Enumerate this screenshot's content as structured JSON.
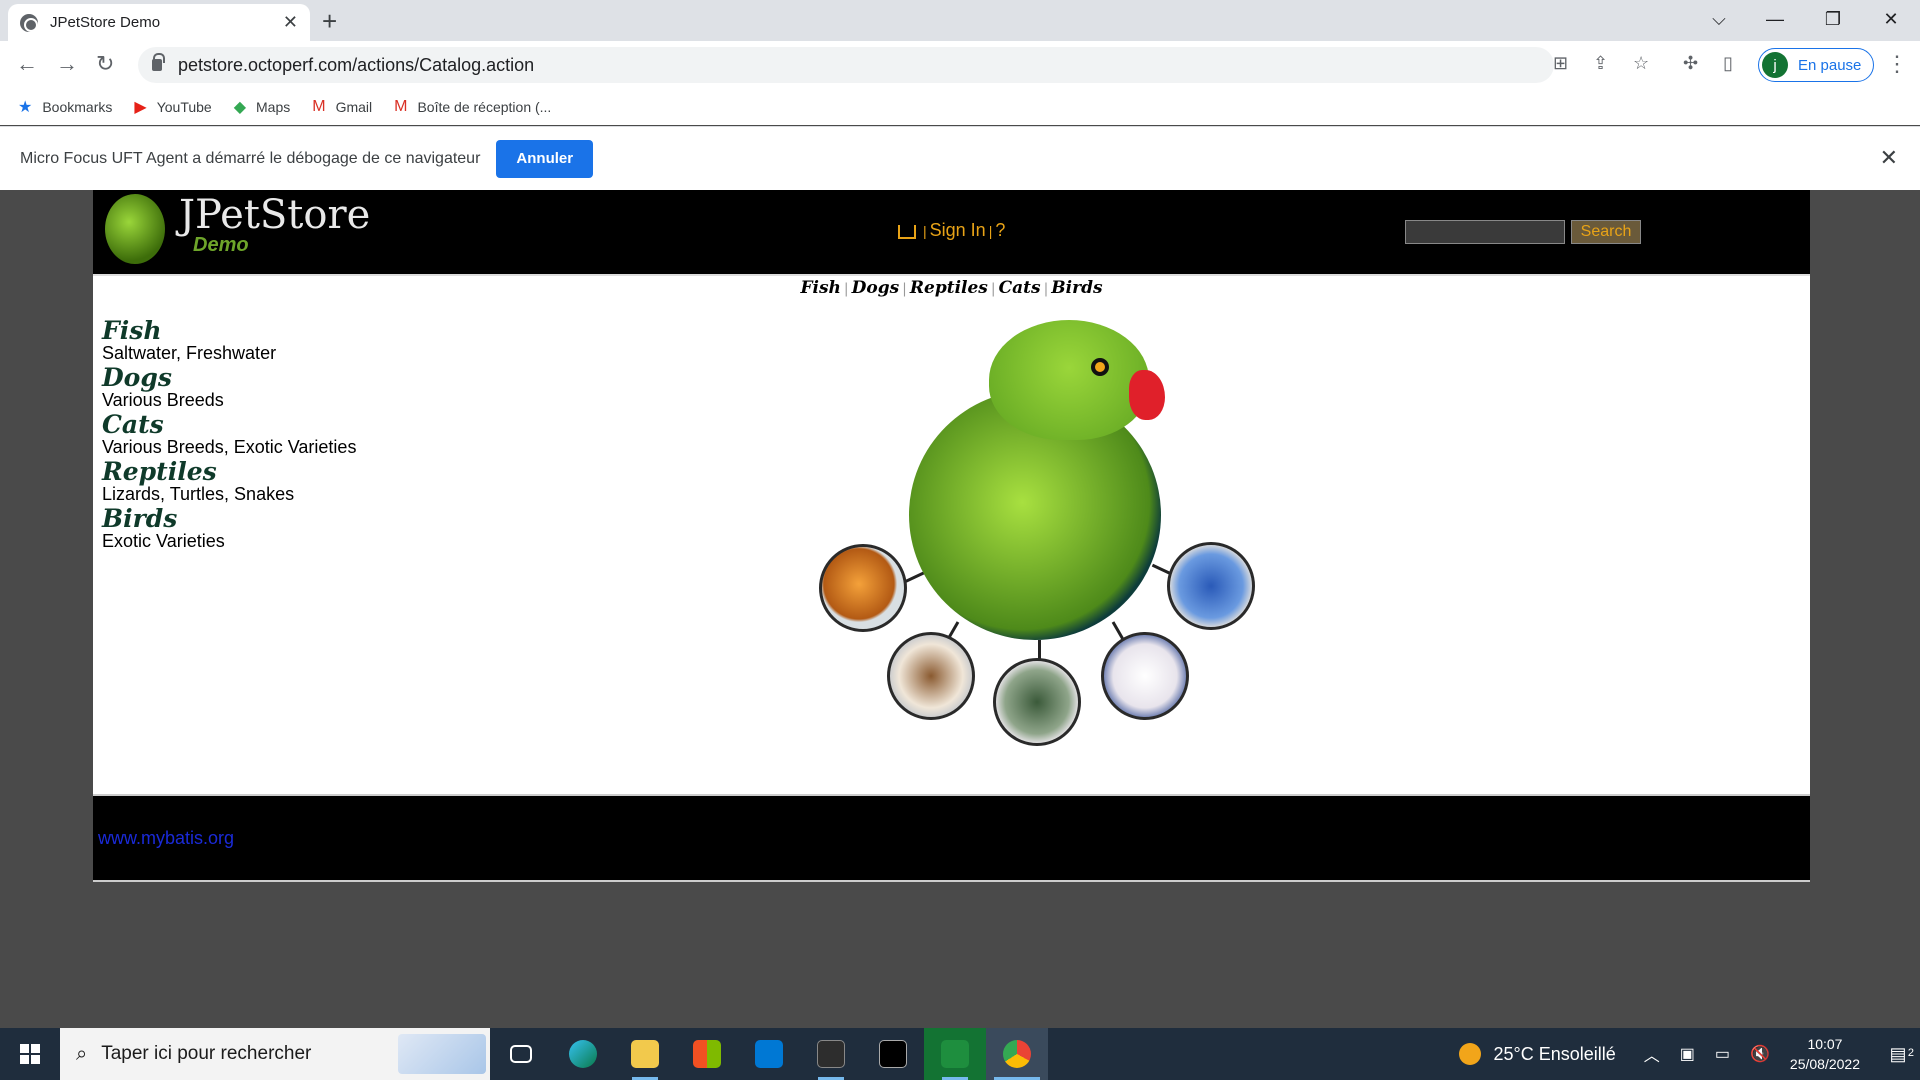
{
  "browser": {
    "tab_title": "JPetStore Demo",
    "tab_close": "✕",
    "new_tab": "+",
    "url": "petstore.octoperf.com/actions/Catalog.action",
    "profile_initial": "j",
    "profile_status": "En pause",
    "bookmarks": [
      {
        "label": "Bookmarks",
        "icon": "star-icon"
      },
      {
        "label": "YouTube",
        "icon": "youtube-icon"
      },
      {
        "label": "Maps",
        "icon": "maps-icon"
      },
      {
        "label": "Gmail",
        "icon": "gmail-icon"
      },
      {
        "label": "Boîte de réception (...",
        "icon": "gmail-icon"
      }
    ],
    "infobar_message": "Micro Focus UFT Agent a démarré le débogage de ce navigateur",
    "infobar_button": "Annuler"
  },
  "site": {
    "logo_title": "JPetStore",
    "logo_subtitle": "Demo",
    "sign_in": "Sign In",
    "help": "?",
    "search_button": "Search",
    "quicklinks": [
      "Fish",
      "Dogs",
      "Reptiles",
      "Cats",
      "Birds"
    ],
    "categories": [
      {
        "name": "Fish",
        "desc": "Saltwater, Freshwater"
      },
      {
        "name": "Dogs",
        "desc": "Various Breeds"
      },
      {
        "name": "Cats",
        "desc": "Various Breeds, Exotic Varieties"
      },
      {
        "name": "Reptiles",
        "desc": "Lizards, Turtles, Snakes"
      },
      {
        "name": "Birds",
        "desc": "Exotic Varieties"
      }
    ],
    "footer_link": "www.mybatis.org"
  },
  "taskbar": {
    "search_placeholder": "Taper ici pour rechercher",
    "weather": "25°C  Ensoleillé",
    "time": "10:07",
    "date": "25/08/2022",
    "notifications": "2"
  },
  "colors": {
    "accent": "#1a73e8",
    "header_link": "#e8a317",
    "footer_link": "#1a2ad8"
  }
}
